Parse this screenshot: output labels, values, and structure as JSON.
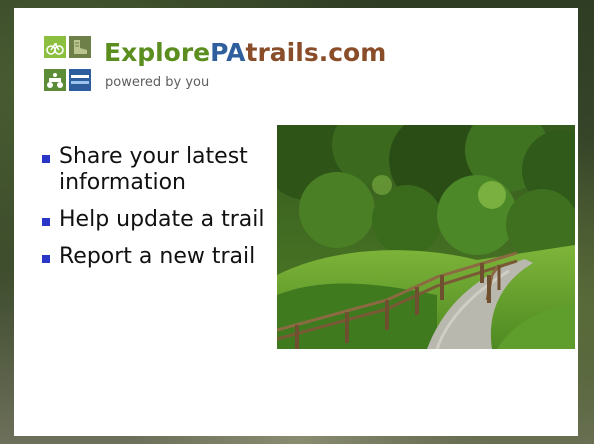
{
  "logo": {
    "title_part1": "Explore",
    "title_part2": "PA",
    "title_part3": "trails.com",
    "tagline": "powered by you",
    "colors": {
      "green": "#5b8e1f",
      "blue": "#2f5f9c",
      "brown": "#8a4d2a"
    }
  },
  "bullets": [
    {
      "text": "Share your latest information"
    },
    {
      "text": "Help update a trail"
    },
    {
      "text": "Report a new trail"
    }
  ],
  "bullet_color": "#2a36c8",
  "photo": {
    "subject": "trail-photo"
  }
}
